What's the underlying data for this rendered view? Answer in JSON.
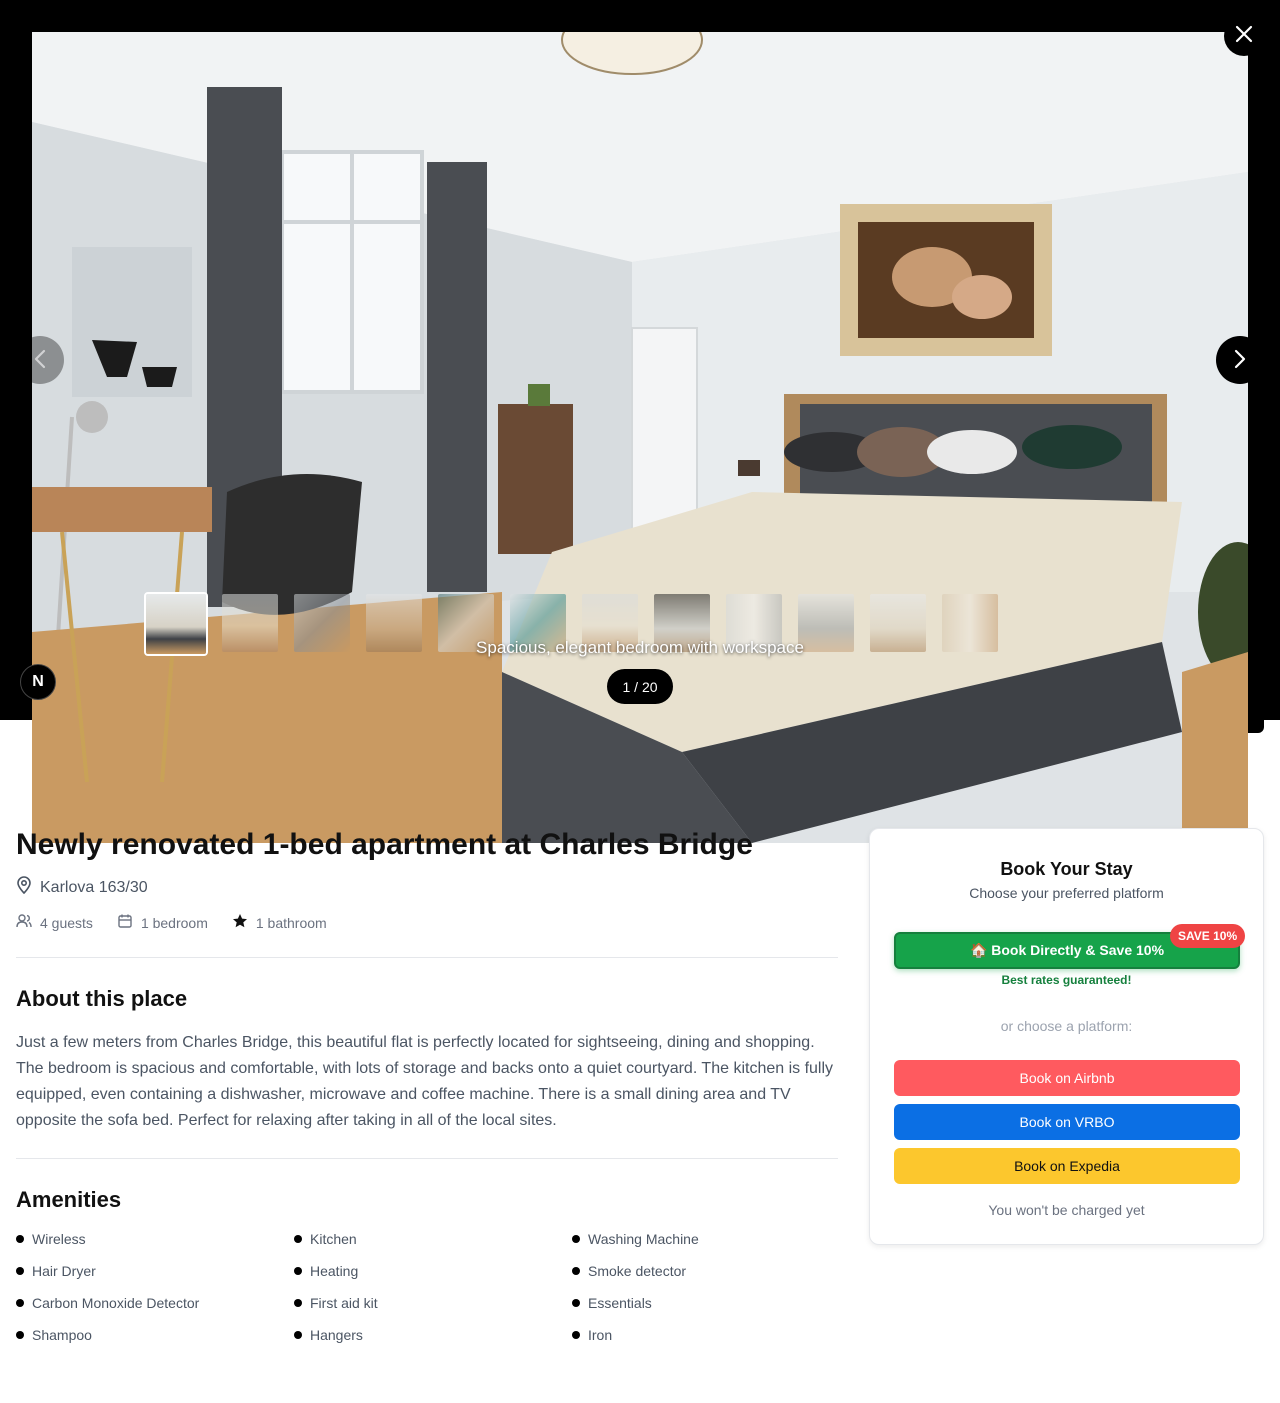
{
  "gallery": {
    "caption": "Spacious, elegant bedroom with workspace",
    "counter": "1 / 20",
    "close_icon": "close-icon",
    "prev_icon": "chevron-left-icon",
    "next_icon": "chevron-right-icon",
    "badge_letter": "N",
    "thumbnail_count": 12,
    "active_thumbnail": 1
  },
  "listing": {
    "title": "Newly renovated 1-bed apartment at Charles Bridge",
    "address": "Karlova 163/30",
    "stats": {
      "guests": "4 guests",
      "bedrooms": "1 bedroom",
      "bathrooms": "1 bathroom"
    },
    "about_heading": "About this place",
    "description": "Just a few meters from Charles Bridge, this beautiful flat is perfectly located for sightseeing, dining and shopping. The bedroom is spacious and comfortable, with lots of storage and backs onto a quiet courtyard. The kitchen is fully equipped, even containing a dishwasher, microwave and coffee machine. There is a small dining area and TV opposite the sofa bed. Perfect for relaxing after taking in all of the local sites.",
    "amenities_heading": "Amenities",
    "amenities": [
      "Wireless",
      "Kitchen",
      "Washing Machine",
      "Hair Dryer",
      "Heating",
      "Smoke detector",
      "Carbon Monoxide Detector",
      "First aid kit",
      "Essentials",
      "Shampoo",
      "Hangers",
      "Iron"
    ]
  },
  "booking": {
    "title": "Book Your Stay",
    "subtitle": "Choose your preferred platform",
    "direct_label": "🏠 Book Directly & Save 10%",
    "save_badge": "SAVE 10%",
    "best_rates": "Best rates guaranteed!",
    "or_choose": "or choose a platform:",
    "airbnb_label": "Book on Airbnb",
    "vrbo_label": "Book on VRBO",
    "expedia_label": "Book on Expedia",
    "no_charge": "You won't be charged yet"
  },
  "colors": {
    "direct": "#16a34a",
    "airbnb": "#ff5a5f",
    "vrbo": "#0b6fe4",
    "expedia": "#fcc72d",
    "save_badge": "#ef4444"
  }
}
